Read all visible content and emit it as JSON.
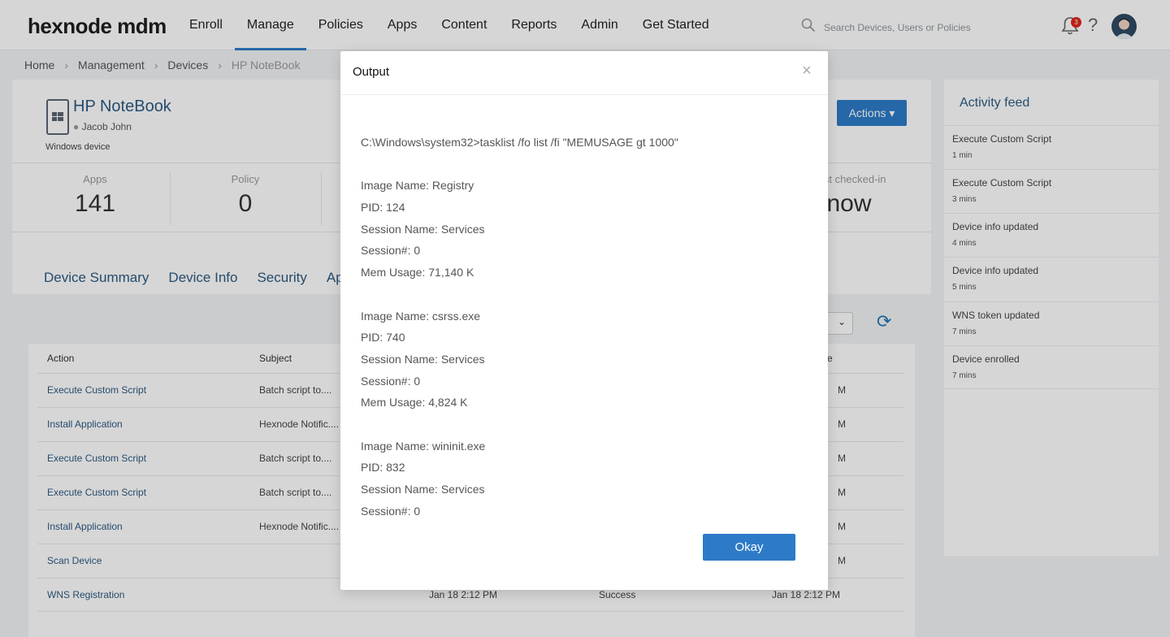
{
  "app": {
    "logo": "hexnode mdm"
  },
  "nav": {
    "items": [
      "Enroll",
      "Manage",
      "Policies",
      "Apps",
      "Content",
      "Reports",
      "Admin",
      "Get Started"
    ],
    "active": "Manage"
  },
  "search": {
    "placeholder": "Search Devices, Users or Policies"
  },
  "notifications": {
    "count": "3"
  },
  "help": {
    "label": "?"
  },
  "breadcrumb": [
    "Home",
    "Management",
    "Devices",
    "HP NoteBook"
  ],
  "device": {
    "name": "HP NoteBook",
    "user": "Jacob John",
    "type": "Windows device",
    "actions_label": "Actions"
  },
  "stats": [
    {
      "label": "Apps",
      "value": "141"
    },
    {
      "label": "Policy",
      "value": "0"
    },
    {
      "label": "Last checked-in",
      "value": "now"
    }
  ],
  "tabs": [
    "Device Summary",
    "Device Info",
    "Security",
    "Ap"
  ],
  "table": {
    "headers": [
      "Action",
      "Subject",
      "e"
    ],
    "rows": [
      {
        "action": "Execute Custom Script",
        "subject": "Batch script to....",
        "c3": "",
        "c4": "",
        "c5": "M"
      },
      {
        "action": "Install Application",
        "subject": "Hexnode Notific....",
        "c3": "",
        "c4": "",
        "c5": "M"
      },
      {
        "action": "Execute Custom Script",
        "subject": "Batch script to....",
        "c3": "",
        "c4": "",
        "c5": "M"
      },
      {
        "action": "Execute Custom Script",
        "subject": "Batch script to....",
        "c3": "",
        "c4": "",
        "c5": "M"
      },
      {
        "action": "Install Application",
        "subject": "Hexnode Notific....",
        "c3": "",
        "c4": "",
        "c5": "M"
      },
      {
        "action": "Scan Device",
        "subject": "",
        "c3": "",
        "c4": "",
        "c5": "M"
      },
      {
        "action": "WNS Registration",
        "subject": "",
        "c3": "Jan 18 2:12 PM",
        "c4": "Success",
        "c5": "Jan 18 2:12 PM"
      }
    ]
  },
  "activity": {
    "title": "Activity feed",
    "items": [
      {
        "name": "Execute Custom Script",
        "time": "1 min"
      },
      {
        "name": "Execute Custom Script",
        "time": "3 mins"
      },
      {
        "name": "Device info updated",
        "time": "4 mins"
      },
      {
        "name": "Device info updated",
        "time": "5 mins"
      },
      {
        "name": "WNS token updated",
        "time": "7 mins"
      },
      {
        "name": "Device enrolled",
        "time": "7 mins"
      }
    ]
  },
  "modal": {
    "title": "Output",
    "close": "×",
    "okay_label": "Okay",
    "lines": [
      "C:\\Windows\\system32>tasklist /fo list /fi \"MEMUSAGE gt 1000\"",
      "",
      "Image Name: Registry",
      "PID: 124",
      "Session Name: Services",
      "Session#: 0",
      "Mem Usage: 71,140 K",
      "",
      "Image Name: csrss.exe",
      "PID: 740",
      "Session Name: Services",
      "Session#: 0",
      "Mem Usage: 4,824 K",
      "",
      "Image Name: wininit.exe",
      "PID: 832",
      "Session Name: Services",
      "Session#: 0"
    ]
  },
  "colors": {
    "accent": "#2d7bc8",
    "link": "#2d5a82",
    "badge": "#e2231a"
  }
}
